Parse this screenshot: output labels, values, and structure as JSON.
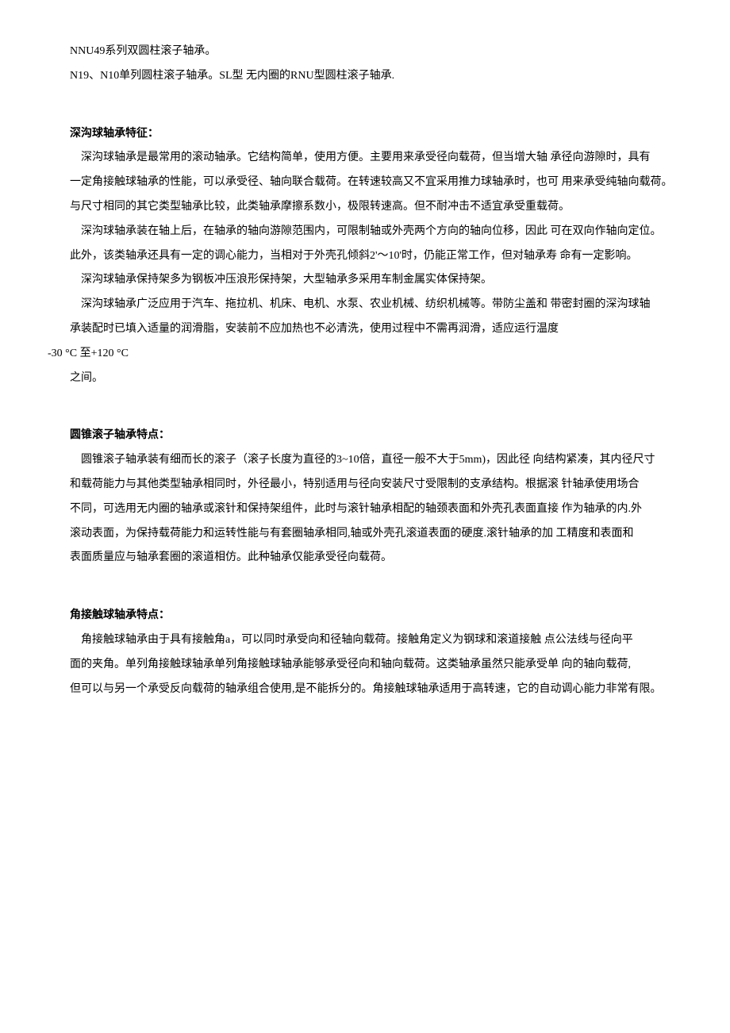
{
  "intro": {
    "line1": "NNU49系列双圆柱滚子轴承。",
    "line2": "N19、N10单列圆柱滚子轴承。SL型 无内圈的RNU型圆柱滚子轴承."
  },
  "section1": {
    "heading": "深沟球轴承特征：",
    "p1": "深沟球轴承是最常用的滚动轴承。它结构简单，使用方便。主要用来承受径向载荷，但当增大轴  承径向游隙时，具有",
    "p2": "一定角接触球轴承的性能，可以承受径、轴向联合载荷。在转速较高又不宜采用推力球轴承时，也可  用来承受纯轴向载荷。",
    "p3": "与尺寸相同的其它类型轴承比较，此类轴承摩擦系数小，极限转速高。但不耐冲击不适宜承受重载荷。",
    "p4": "深沟球轴承装在轴上后，在轴承的轴向游隙范围内，可限制轴或外壳两个方向的轴向位移，因此  可在双向作轴向定位。",
    "p5": "此外，该类轴承还具有一定的调心能力，当相对于外壳孔倾斜2'～10'时，仍能正常工作，但对轴承寿  命有一定影响。",
    "p6": "深沟球轴承保持架多为钢板冲压浪形保持架，大型轴承多采用车制金属实体保持架。",
    "p7": "深沟球轴承广泛应用于汽车、拖拉机、机床、电机、水泵、农业机械、纺织机械等。带防尘盖和  带密封圈的深沟球轴",
    "p8": "承装配时已填入适量的润滑脂，安装前不应加热也不必清洗，使用过程中不需再润滑，适应运行温度",
    "p9": "-30 °C 至+120 °C",
    "p10": "之间。"
  },
  "section2": {
    "heading": "圆锥滚子轴承特点：",
    "p1": "圆锥滚子轴承装有细而长的滚子（滚子长度为直径的3~10倍，直径一般不大于5mm)，因此径  向结构紧凑，其内径尺寸",
    "p2": "和载荷能力与其他类型轴承相同时，外径最小，特别适用与径向安装尺寸受限制的支承结构。根据滚  针轴承使用场合",
    "p3": "不同，可选用无内圈的轴承或滚针和保持架组件，此时与滚针轴承相配的轴颈表面和外壳孔表面直接  作为轴承的内.外",
    "p4": "滚动表面，为保持载荷能力和运转性能与有套圈轴承相同,轴或外壳孔滚道表面的硬度.滚针轴承的加  工精度和表面和",
    "p5": "表面质量应与轴承套圈的滚道相仿。此种轴承仅能承受径向载荷。"
  },
  "section3": {
    "heading": "角接触球轴承特点：",
    "p1": "角接触球轴承由于具有接触角a，可以同时承受向和径轴向载荷。接触角定义为钢球和滚道接触  点公法线与径向平",
    "p2": "面的夹角。单列角接触球轴承单列角接触球轴承能够承受径向和轴向载荷。这类轴承虽然只能承受单  向的轴向载荷,",
    "p3": "但可以与另一个承受反向载荷的轴承组合使用,是不能拆分的。角接触球轴承适用于高转速，它的自动调心能力非常有限。"
  }
}
